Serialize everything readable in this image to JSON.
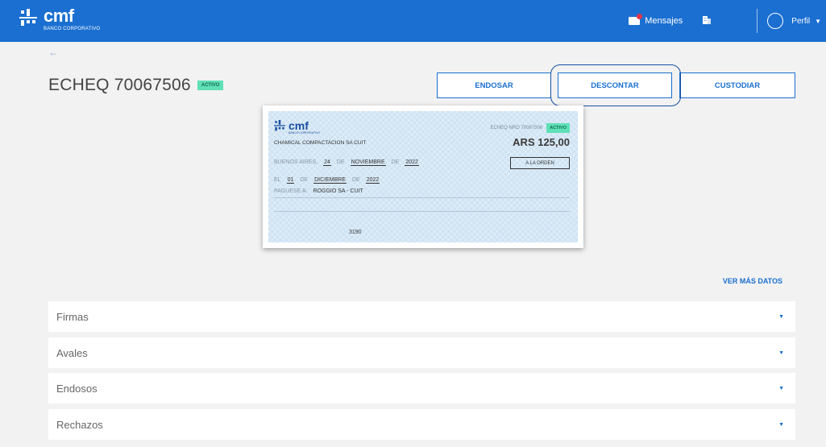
{
  "header": {
    "brand": "cmf",
    "brand_sub": "BANCO CORPORATIVO",
    "messages_label": "Mensajes",
    "profile_label": "Perfil",
    "colors": {
      "primary": "#1a6fd1",
      "badge": "#5fe0b6",
      "notification": "#e0364c"
    }
  },
  "page": {
    "back_icon": "arrow-left-icon",
    "title": "ECHEQ 70067506",
    "status": "ACTIVO"
  },
  "actions": {
    "endosar": "ENDOSAR",
    "descontar": "DESCONTAR",
    "custodiar": "CUSTODIAR"
  },
  "cheque": {
    "brand": "cmf",
    "brand_sub": "BANCO CORPORATIVO",
    "number_label": "ECHEQ NRO 70067506",
    "status": "ACTIVO",
    "company": "CHAMICAL COMPACTACION SA CUIT",
    "amount": "ARS 125,00",
    "place": "BUENOS AIRES,",
    "day": "24",
    "de1": "DE",
    "month": "NOVIEMBRE",
    "de2": "DE",
    "year": "2022",
    "order_type": "A LA ORDEN",
    "el": "EL",
    "pay_day": "01",
    "de3": "DE",
    "pay_month": "DICIEMBRE",
    "de4": "DE",
    "pay_year": "2022",
    "payee_label": "PAGUESE A:",
    "payee": "ROGGIO SA - CUIT",
    "bottom_number": "3190"
  },
  "ver_mas": "VER MÁS DATOS",
  "sections": [
    {
      "label": "Firmas"
    },
    {
      "label": "Avales"
    },
    {
      "label": "Endosos"
    },
    {
      "label": "Rechazos"
    }
  ]
}
